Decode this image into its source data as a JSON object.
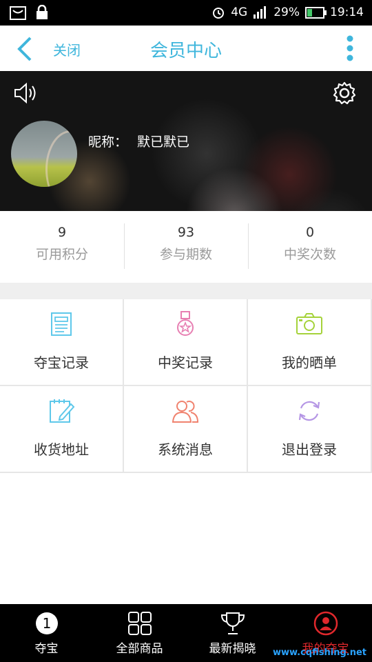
{
  "status_bar": {
    "network": "4G",
    "battery": "29%",
    "battery_fraction": 0.29,
    "time": "19:14"
  },
  "header": {
    "close_label": "关闭",
    "title": "会员中心"
  },
  "profile": {
    "nickname_label": "昵称：",
    "nickname": "默已默已"
  },
  "stats": [
    {
      "value": "9",
      "label": "可用积分"
    },
    {
      "value": "93",
      "label": "参与期数"
    },
    {
      "value": "0",
      "label": "中奖次数"
    }
  ],
  "menu": [
    {
      "label": "夺宝记录",
      "icon": "document-icon",
      "color": "#5ec8ea"
    },
    {
      "label": "中奖记录",
      "icon": "medal-icon",
      "color": "#e77fb2"
    },
    {
      "label": "我的晒单",
      "icon": "camera-icon",
      "color": "#a5d23a"
    },
    {
      "label": "收货地址",
      "icon": "edit-note-icon",
      "color": "#5ec8ea"
    },
    {
      "label": "系统消息",
      "icon": "users-icon",
      "color": "#f0826e"
    },
    {
      "label": "退出登录",
      "icon": "refresh-icon",
      "color": "#b596e5"
    }
  ],
  "tabs": [
    {
      "label": "夺宝",
      "icon": "number-one-icon"
    },
    {
      "label": "全部商品",
      "icon": "grid-icon"
    },
    {
      "label": "最新揭晓",
      "icon": "trophy-icon"
    },
    {
      "label": "我的夺宝",
      "icon": "user-icon",
      "active_color": "#e0282c"
    }
  ],
  "watermark": "www.cqfishing.net"
}
